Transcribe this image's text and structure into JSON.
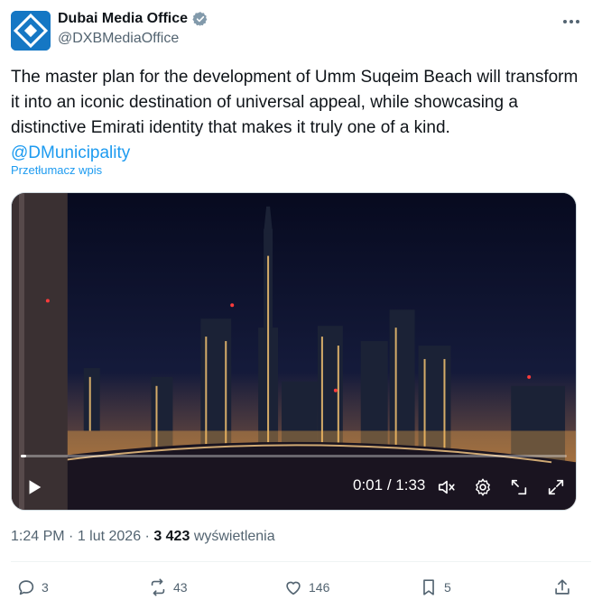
{
  "account": {
    "display_name": "Dubai Media Office",
    "handle": "@DXBMediaOffice",
    "avatar_icon": "dubai-media-office-logo",
    "verified_icon": "verified-badge-icon"
  },
  "tweet": {
    "text": "The master plan for the development of Umm Suqeim Beach will transform it into an iconic destination of universal appeal, while showcasing a distinctive Emirati identity that makes it truly one of a kind.",
    "mention": "@DMunicipality",
    "translate_label": "Przetłumacz wpis"
  },
  "video": {
    "current_time": "0:01",
    "separator": " / ",
    "duration": "1:33",
    "progress": 0.01
  },
  "meta": {
    "time": "1:24 PM",
    "dot": " · ",
    "date": "1 lut 2026",
    "views_count": "3 423",
    "views_label": "wyświetlenia"
  },
  "actions": {
    "replies": "3",
    "reposts": "43",
    "likes": "146",
    "bookmarks": "5"
  },
  "colors": {
    "accent": "#1d9bf0",
    "verified": "#829aab",
    "muted": "#536471"
  }
}
